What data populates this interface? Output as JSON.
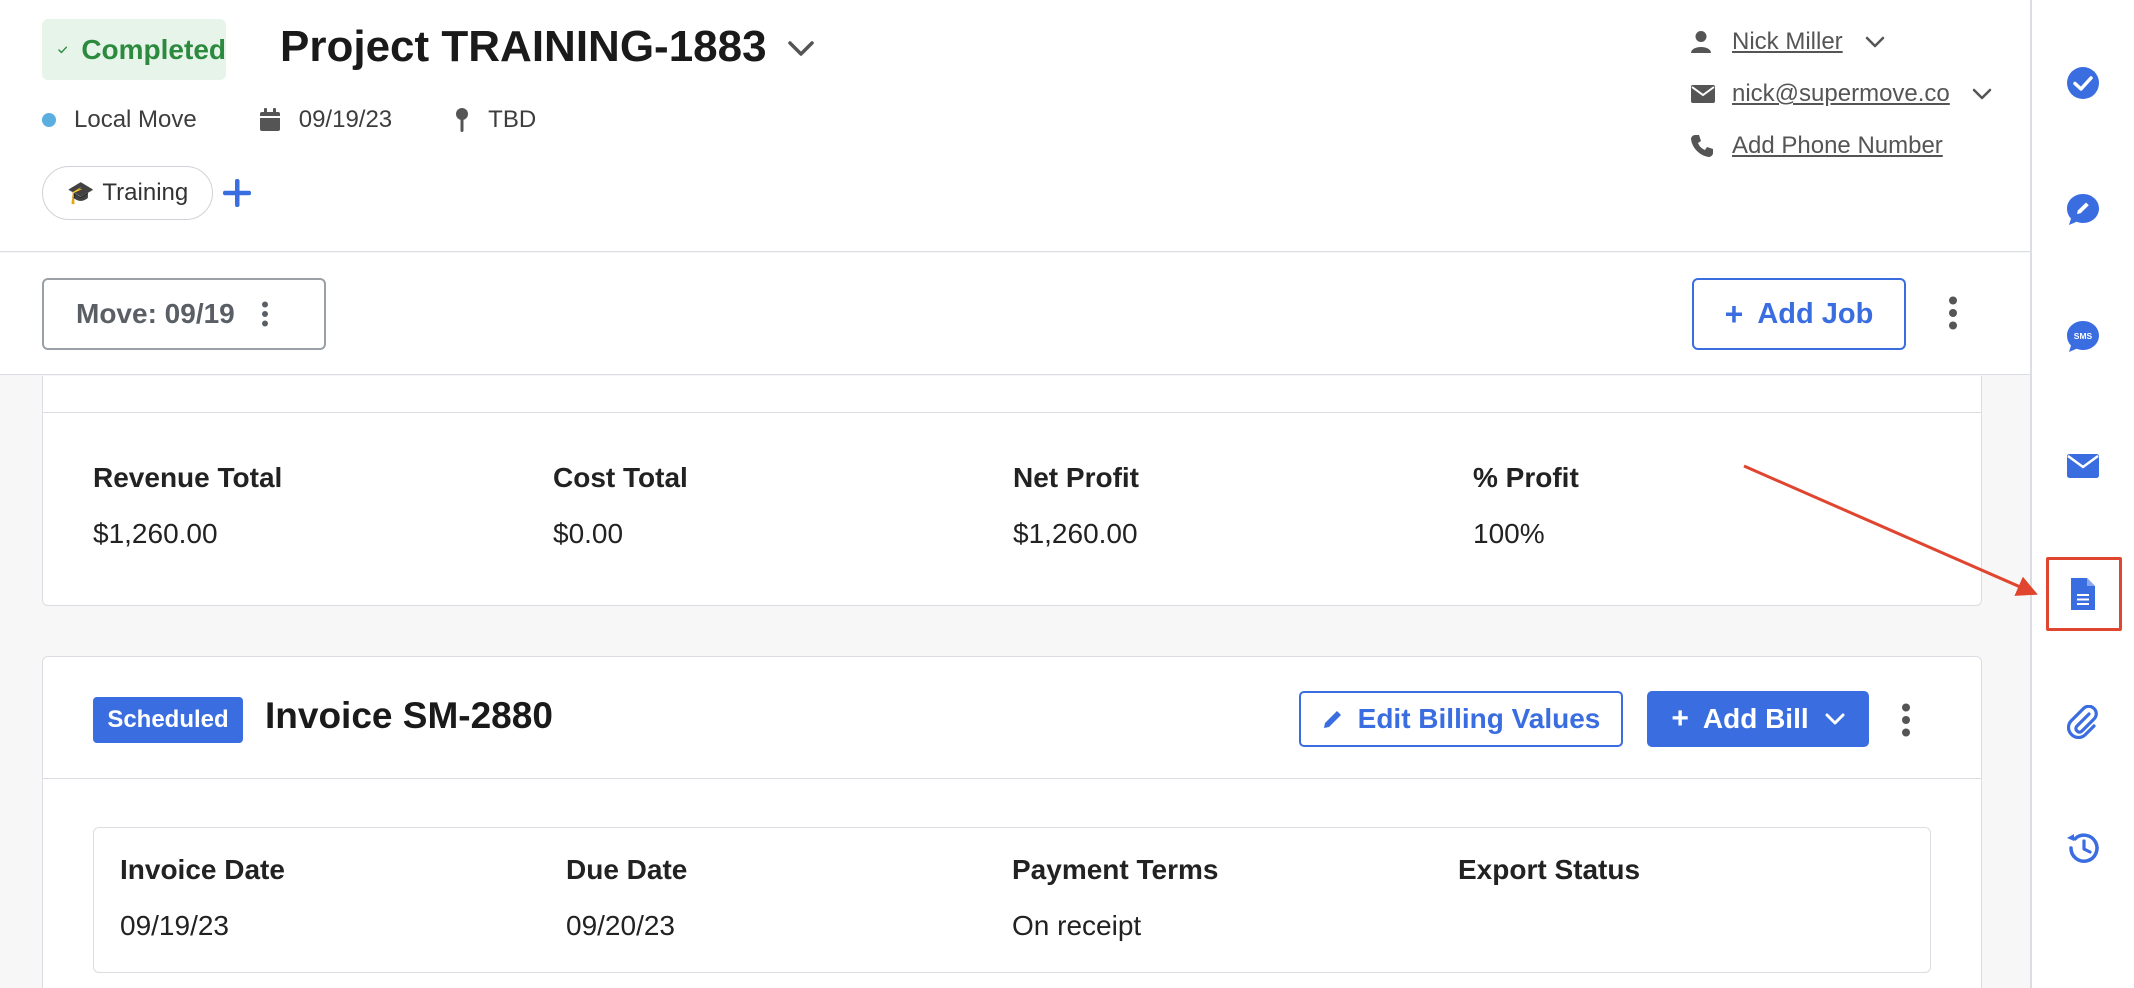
{
  "header": {
    "status_label": "Completed",
    "project_title": "Project TRAINING-1883",
    "project_type": "Local Move",
    "project_type_color": "#5aaee0",
    "date": "09/19/23",
    "location": "TBD",
    "tag_emoji": "🎓",
    "tag_label": "Training"
  },
  "contact": {
    "name": "Nick Miller",
    "email": "nick@supermove.co",
    "phone_link": "Add Phone Number"
  },
  "job_bar": {
    "move_label": "Move: 09/19",
    "add_job_label": "Add Job"
  },
  "summary": {
    "revenue_label": "Revenue Total",
    "revenue_value": "$1,260.00",
    "cost_label": "Cost Total",
    "cost_value": "$0.00",
    "net_label": "Net Profit",
    "net_value": "$1,260.00",
    "pct_label": "% Profit",
    "pct_value": "100%"
  },
  "invoice": {
    "status_badge": "Scheduled",
    "title": "Invoice SM-2880",
    "edit_label": "Edit Billing Values",
    "add_bill_label": "Add Bill",
    "fields": [
      {
        "label": "Invoice Date",
        "value": "09/19/23"
      },
      {
        "label": "Due Date",
        "value": "09/20/23"
      },
      {
        "label": "Payment Terms",
        "value": "On receipt"
      },
      {
        "label": "Export Status",
        "value": ""
      }
    ]
  },
  "sidebar": {
    "icons": [
      "check-circle-icon",
      "edit-chat-icon",
      "sms-icon",
      "mail-icon",
      "document-icon",
      "paperclip-icon",
      "history-icon"
    ],
    "sms_glyph": "SMS",
    "accent_color": "#3a6de0"
  },
  "annotation": {
    "color": "#e0452f"
  }
}
